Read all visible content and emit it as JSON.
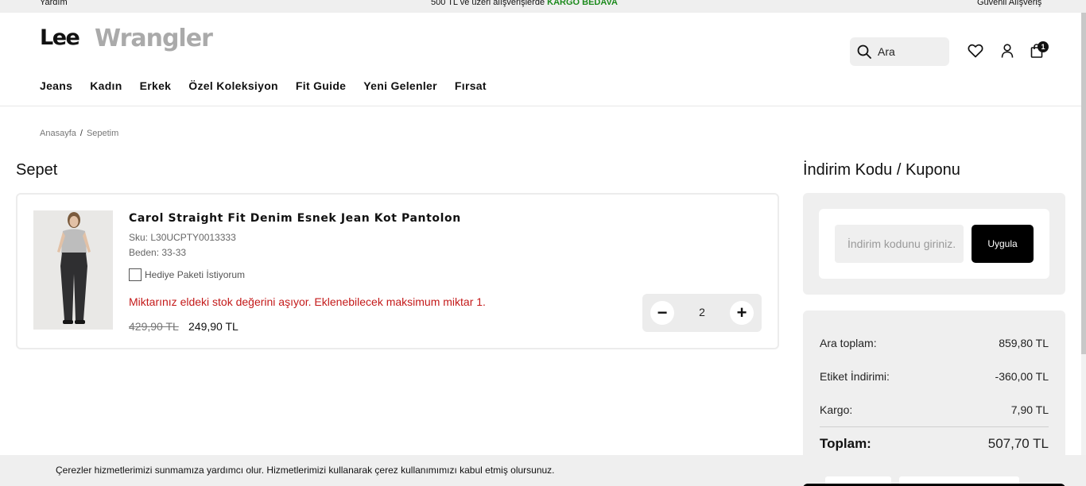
{
  "topbar": {
    "left": "Yardım",
    "center_prefix": "500 TL ve üzeri alışverişlerde",
    "center_highlight": "KARGO BEDAVA",
    "right": "Güvenli Alışveriş",
    "highlight_color": "#1c8a1c"
  },
  "header": {
    "brands": [
      "Lee",
      "Wrangler"
    ],
    "nav": [
      "Jeans",
      "Kadın",
      "Erkek",
      "Özel Koleksiyon",
      "Fit Guide",
      "Yeni Gelenler",
      "Fırsat"
    ],
    "search_placeholder": "Ara",
    "cart_count": "1",
    "icons": [
      "search-icon",
      "heart-icon",
      "user-icon",
      "bag-icon"
    ]
  },
  "breadcrumb": {
    "items": [
      "Anasayfa",
      "Sepetim"
    ],
    "separator": "/"
  },
  "cart": {
    "title": "Sepet",
    "item": {
      "name": "Carol Straight Fit Denim Esnek Jean Kot Pantolon",
      "sku": "Sku: L30UCPTY0013333",
      "size": "Beden: 33-33",
      "gift_label": "Hediye Paketi İstiyorum",
      "warning": "Miktarınız eldeki stok değerini aşıyor. Eklenebilecek maksimum miktar 1.",
      "old_price": "429,90 TL",
      "price": "249,90 TL",
      "quantity": "2",
      "minus": "−",
      "plus": "+"
    }
  },
  "coupon": {
    "title": "İndirim Kodu / Kuponu",
    "placeholder": "İndirim kodunu giriniz.",
    "apply_label": "Uygula"
  },
  "summary": {
    "subtotal_label": "Ara toplam:",
    "subtotal_value": "859,80 TL",
    "discount_label": "Etiket İndirimi:",
    "discount_value": "-360,00 TL",
    "shipping_label": "Kargo:",
    "shipping_value": "7,90 TL",
    "total_label": "Toplam:",
    "total_value": "507,70 TL"
  },
  "cookie": {
    "text": "Çerezler hizmetlerimizi sunmamıza yardımcı olur. Hizmetlerimizi kullanarak çerez kullanımımızı kabul etmiş olursunuz."
  }
}
